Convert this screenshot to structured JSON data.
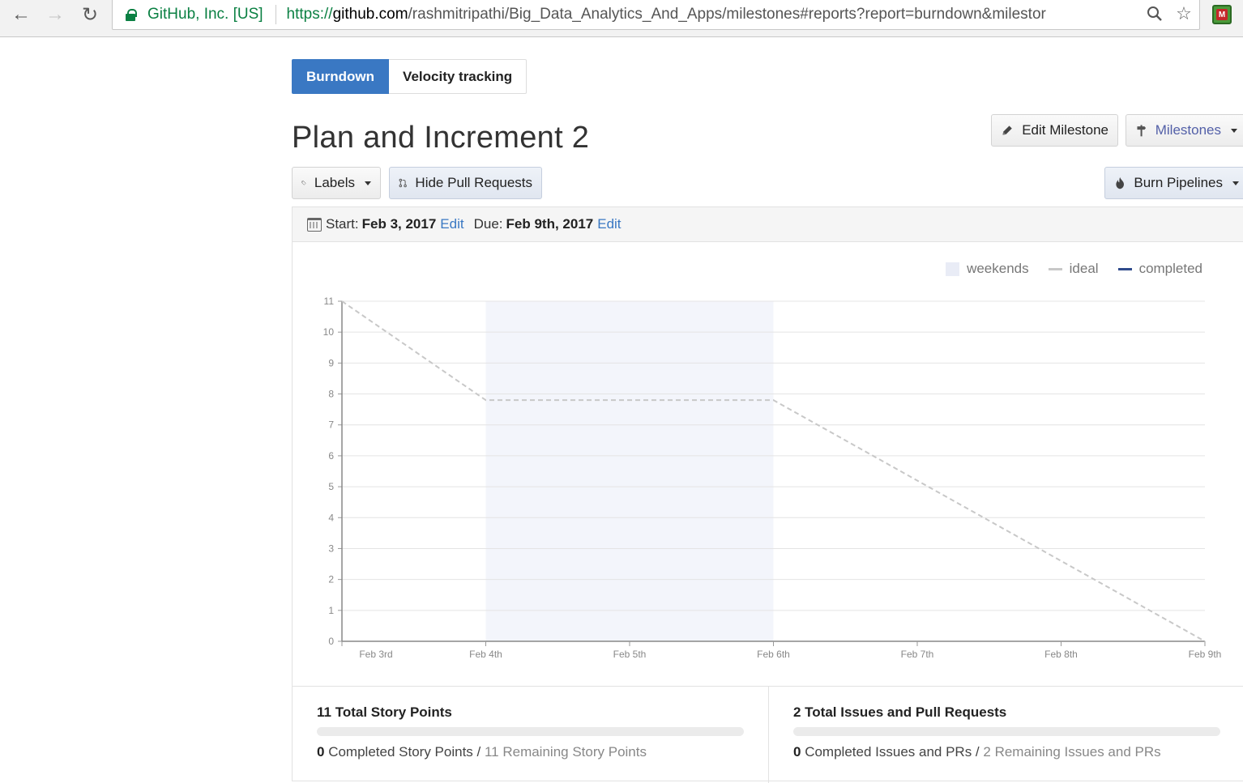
{
  "browser": {
    "security_org": "GitHub, Inc. [US]",
    "url_scheme": "https://",
    "url_host": "github.com",
    "url_path": "/rashmitripathi/Big_Data_Analytics_And_Apps/milestones#reports?report=burndown&milestor"
  },
  "tabs": [
    {
      "label": "Burndown",
      "active": true
    },
    {
      "label": "Velocity tracking",
      "active": false
    }
  ],
  "milestone": {
    "title": "Plan and Increment 2"
  },
  "toolbar": {
    "edit_milestone": "Edit Milestone",
    "milestones": "Milestones",
    "labels": "Labels",
    "hide_pull_requests": "Hide Pull Requests",
    "burn_pipelines": "Burn Pipelines"
  },
  "dates": {
    "start_label": "Start:",
    "start_value": "Feb 3, 2017",
    "start_edit": "Edit",
    "due_label": "Due:",
    "due_value": "Feb 9th, 2017",
    "due_edit": "Edit"
  },
  "legend": {
    "weekends": "weekends",
    "ideal": "ideal",
    "completed": "completed"
  },
  "colors": {
    "accent": "#3a78c3",
    "weekend_band": "#f3f5fb",
    "ideal_line": "#c8c8c8",
    "completed_line": "#2f4b8c"
  },
  "chart_data": {
    "type": "line",
    "categories": [
      "Feb 3rd",
      "Feb 4th",
      "Feb 5th",
      "Feb 6th",
      "Feb 7th",
      "Feb 8th",
      "Feb 9th"
    ],
    "yticks": [
      "0",
      "1",
      "2",
      "3",
      "4",
      "5",
      "6",
      "7",
      "8",
      "9",
      "10",
      "11"
    ],
    "ylim": [
      0,
      11
    ],
    "weekend_band": {
      "from": "Feb 4th",
      "to": "Feb 6th"
    },
    "series": [
      {
        "name": "ideal",
        "style": "dashed",
        "x": [
          "Feb 3rd",
          "Feb 4th",
          "Feb 6th",
          "Feb 9th"
        ],
        "values": [
          11,
          7.8,
          7.8,
          0
        ]
      },
      {
        "name": "completed",
        "style": "solid",
        "x": [],
        "values": []
      }
    ]
  },
  "stats": {
    "story_points": {
      "title": "11 Total Story Points",
      "completed_count": "0",
      "completed_text": "Completed Story Points /",
      "remaining_text": "11 Remaining Story Points",
      "progress": 0
    },
    "issues": {
      "title": "2 Total Issues and Pull Requests",
      "completed_count": "0",
      "completed_text": "Completed Issues and PRs /",
      "remaining_text": "2 Remaining Issues and PRs",
      "progress": 0
    }
  }
}
